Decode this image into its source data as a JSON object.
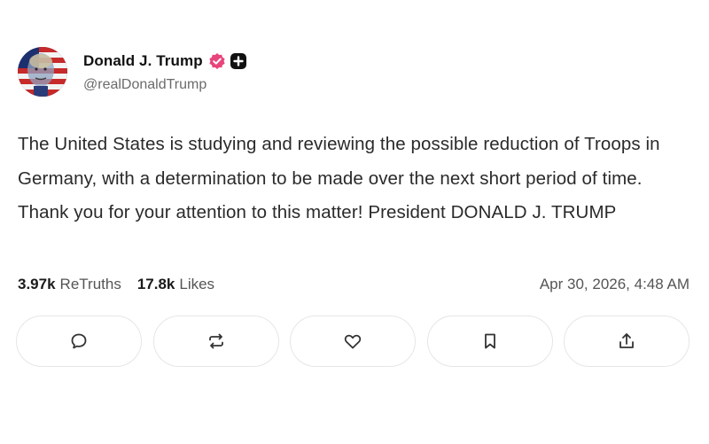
{
  "author": {
    "display_name": "Donald J. Trump",
    "handle": "@realDonaldTrump",
    "avatar_icon": "profile-photo-flag-avatar",
    "verified_badge_color": "#e8457a"
  },
  "post": {
    "text": "The United States is studying and reviewing the possible reduction of Troops in Germany, with a determination to be made over the next short period of time. Thank you for your attention to this matter! President DONALD J. TRUMP"
  },
  "stats": {
    "retruths_count": "3.97k",
    "retruths_label": "ReTruths",
    "likes_count": "17.8k",
    "likes_label": "Likes",
    "timestamp": "Apr 30, 2026, 4:48 AM"
  },
  "actions": [
    {
      "name": "reply",
      "icon": "comment-icon"
    },
    {
      "name": "retruth",
      "icon": "repost-icon"
    },
    {
      "name": "like",
      "icon": "heart-icon"
    },
    {
      "name": "bookmark",
      "icon": "bookmark-icon"
    },
    {
      "name": "share",
      "icon": "share-icon"
    }
  ],
  "colors": {
    "text_primary": "#1a1a1a",
    "text_secondary": "#6b6b6b",
    "button_border": "#e6e6e6"
  }
}
